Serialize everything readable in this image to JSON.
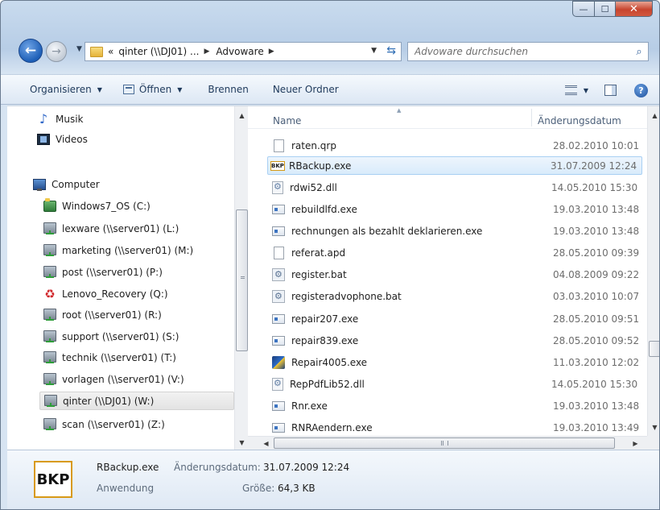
{
  "window": {
    "minimize_glyph": "—",
    "maximize_glyph": "☐",
    "close_glyph": "✕"
  },
  "address_bar": {
    "overflow": "«",
    "crumbs": [
      "qinter (\\\\DJ01) ...",
      "Advoware"
    ],
    "separator": "▶"
  },
  "search": {
    "placeholder": "Advoware durchsuchen"
  },
  "toolbar": {
    "organize": "Organisieren",
    "open": "Öffnen",
    "burn": "Brennen",
    "new_folder": "Neuer Ordner"
  },
  "nav_pane": {
    "items": [
      {
        "label": "Musik",
        "icon": "music-icon"
      },
      {
        "label": "Videos",
        "icon": "videos-icon"
      },
      {
        "label": "Computer",
        "icon": "computer-icon"
      },
      {
        "label": "Windows7_OS (C:)",
        "icon": "local-drive-icon"
      },
      {
        "label": "lexware (\\\\server01) (L:)",
        "icon": "network-drive-icon"
      },
      {
        "label": "marketing (\\\\server01) (M:)",
        "icon": "network-drive-icon"
      },
      {
        "label": "post (\\\\server01) (P:)",
        "icon": "network-drive-icon"
      },
      {
        "label": "Lenovo_Recovery (Q:)",
        "icon": "recovery-drive-icon"
      },
      {
        "label": "root (\\\\server01) (R:)",
        "icon": "network-drive-icon"
      },
      {
        "label": "support (\\\\server01) (S:)",
        "icon": "network-drive-icon"
      },
      {
        "label": "technik (\\\\server01) (T:)",
        "icon": "network-drive-icon"
      },
      {
        "label": "vorlagen (\\\\server01) (V:)",
        "icon": "network-drive-icon"
      },
      {
        "label": "qinter (\\\\DJ01) (W:)",
        "icon": "network-drive-icon",
        "selected": true
      },
      {
        "label": "scan (\\\\server01) (Z:)",
        "icon": "network-drive-icon"
      }
    ]
  },
  "file_list": {
    "columns": {
      "name": "Name",
      "date": "Änderungsdatum"
    },
    "rows": [
      {
        "name": "raten.qrp",
        "date": "28.02.2010 10:01",
        "icon": "document-file-icon"
      },
      {
        "name": "RBackup.exe",
        "date": "31.07.2009 12:24",
        "icon": "bkp-app-icon",
        "selected": true,
        "icon_text": "BKP"
      },
      {
        "name": "rdwi52.dll",
        "date": "14.05.2010 15:30",
        "icon": "dll-file-icon"
      },
      {
        "name": "rebuildlfd.exe",
        "date": "19.03.2010 13:48",
        "icon": "exe-file-icon"
      },
      {
        "name": "rechnungen als bezahlt deklarieren.exe",
        "date": "19.03.2010 13:48",
        "icon": "exe-file-icon"
      },
      {
        "name": "referat.apd",
        "date": "28.05.2010 09:39",
        "icon": "document-file-icon"
      },
      {
        "name": "register.bat",
        "date": "04.08.2009 09:22",
        "icon": "batch-file-icon"
      },
      {
        "name": "registeradvophone.bat",
        "date": "03.03.2010 10:07",
        "icon": "batch-file-icon"
      },
      {
        "name": "repair207.exe",
        "date": "28.05.2010 09:51",
        "icon": "exe-file-icon"
      },
      {
        "name": "repair839.exe",
        "date": "28.05.2010 09:52",
        "icon": "exe-file-icon"
      },
      {
        "name": "Repair4005.exe",
        "date": "11.03.2010 12:02",
        "icon": "repair-app-icon"
      },
      {
        "name": "RepPdfLib52.dll",
        "date": "14.05.2010 15:30",
        "icon": "dll-file-icon"
      },
      {
        "name": "Rnr.exe",
        "date": "19.03.2010 13:48",
        "icon": "exe-file-icon"
      },
      {
        "name": "RNRAendern.exe",
        "date": "19.03.2010 13:49",
        "icon": "exe-file-icon"
      }
    ]
  },
  "details_pane": {
    "icon_text": "BKP",
    "file_name": "RBackup.exe",
    "file_type": "Anwendung",
    "modified_label": "Änderungsdatum:",
    "modified_value": "31.07.2009 12:24",
    "size_label": "Größe:",
    "size_value": "64,3 KB"
  },
  "colors": {
    "selection_border": "#a9d0f3",
    "bkp_border": "#d89a17",
    "close_button": "#c7452f"
  }
}
